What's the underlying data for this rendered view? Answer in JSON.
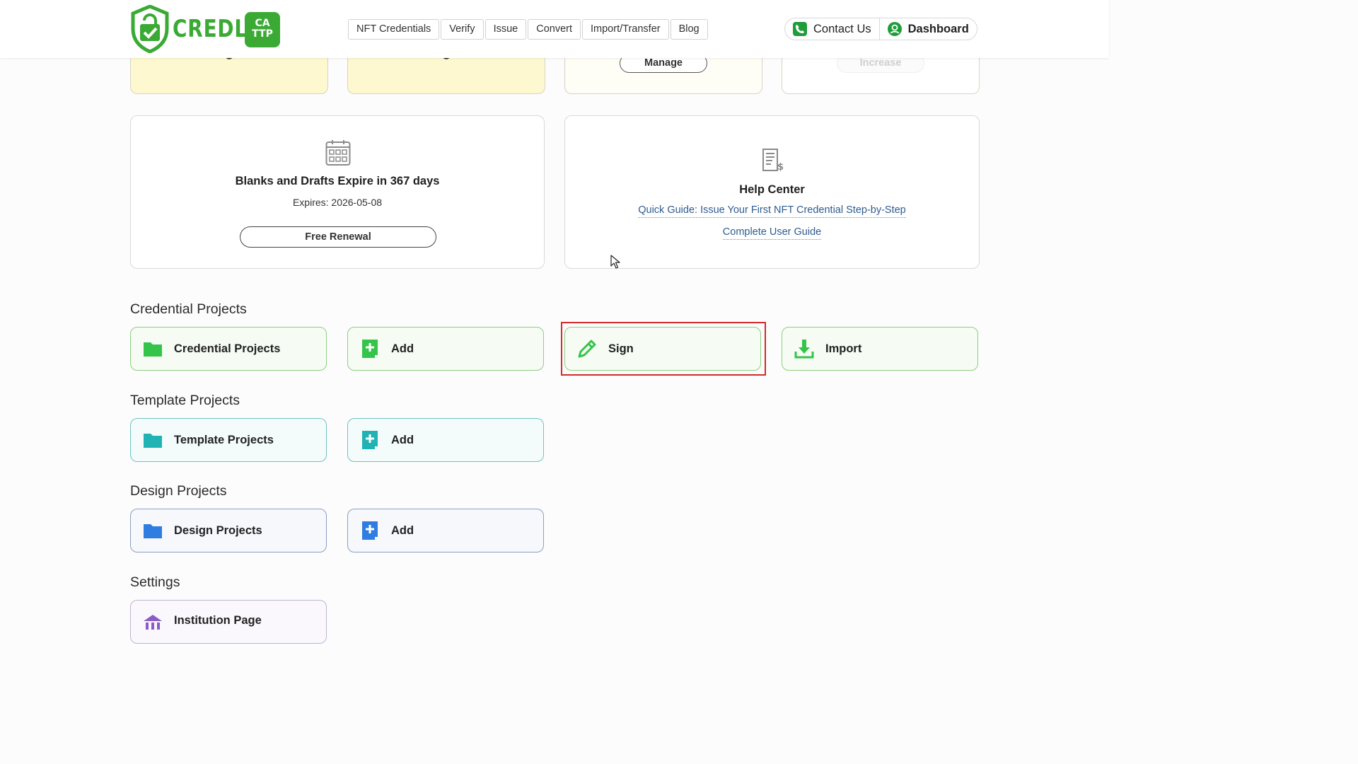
{
  "header": {
    "logo_text": "CREDLY",
    "logo_badge_line1": "CA",
    "logo_badge_line2": "TTP",
    "nav": [
      "NFT Credentials",
      "Verify",
      "Issue",
      "Convert",
      "Import/Transfer",
      "Blog"
    ],
    "contact_label": "Contact Us",
    "dashboard_label": "Dashboard"
  },
  "top_cards": {
    "manage_label": "Manage",
    "increase_label": "Increase"
  },
  "expiry_card": {
    "title": "Blanks and Drafts Expire in 367 days",
    "expires": "Expires: 2026-05-08",
    "renew_label": "Free Renewal"
  },
  "help_card": {
    "title": "Help Center",
    "quick_guide": "Quick Guide: Issue Your First NFT Credential Step-by-Step",
    "user_guide": "Complete User Guide"
  },
  "sections": {
    "credential": {
      "title": "Credential Projects",
      "tiles": [
        "Credential Projects",
        "Add",
        "Sign",
        "Import"
      ]
    },
    "template": {
      "title": "Template Projects",
      "tiles": [
        "Template Projects",
        "Add"
      ]
    },
    "design": {
      "title": "Design Projects",
      "tiles": [
        "Design Projects",
        "Add"
      ]
    },
    "settings": {
      "title": "Settings",
      "tiles": [
        "Institution Page"
      ]
    }
  },
  "colors": {
    "brand_green": "#3aaa35",
    "tile_green": "#35c44a",
    "tile_teal": "#1fb3b3",
    "tile_blue": "#2f7de1",
    "tile_purple": "#8a5cc7",
    "highlight_red": "#d42a2a",
    "link_blue": "#2f5c8f"
  },
  "icons": {
    "contact": "phone-icon",
    "dashboard": "user-circle-icon",
    "expiry": "calendar-icon",
    "help": "invoice-icon",
    "credential_projects": "folder-icon",
    "add": "add-document-icon",
    "sign": "pencil-icon",
    "import": "download-icon",
    "institution": "institution-icon"
  }
}
